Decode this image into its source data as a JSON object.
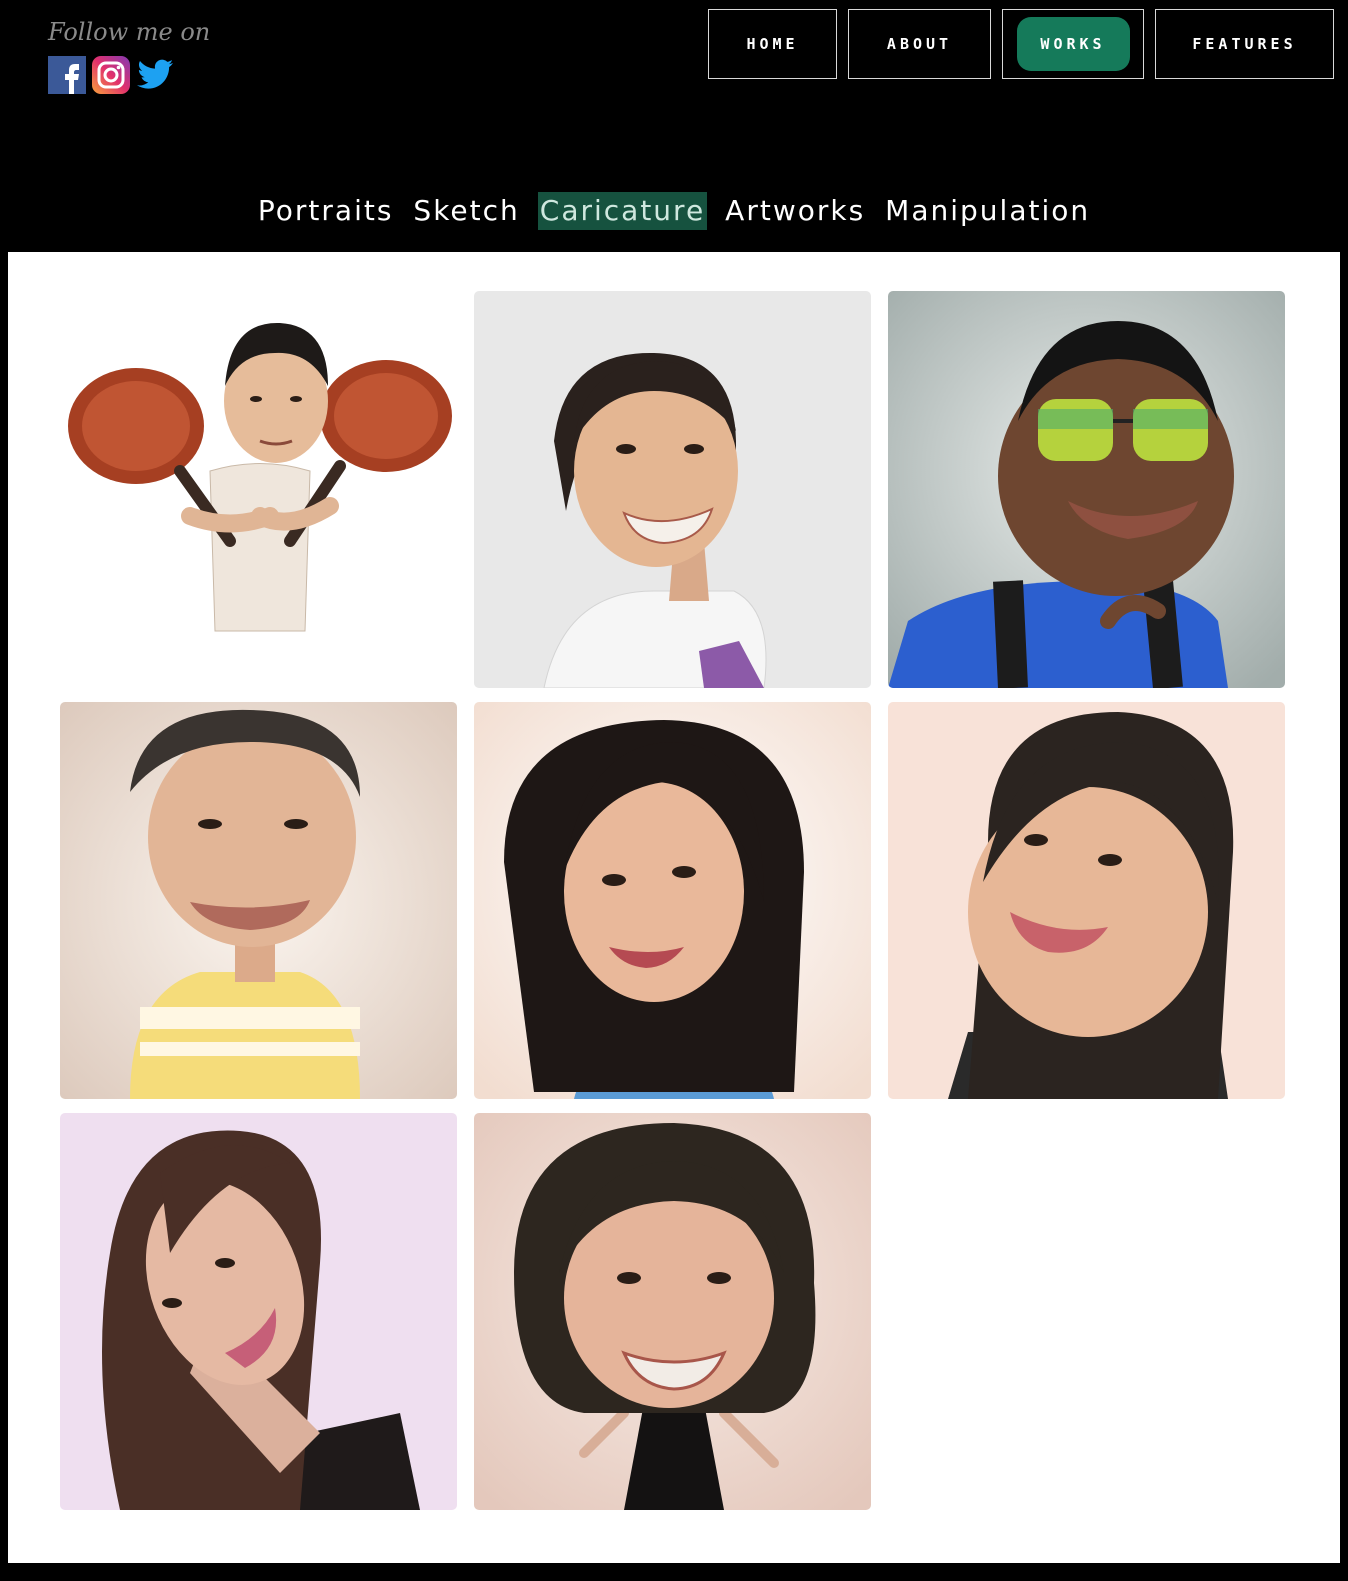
{
  "header": {
    "follow_text": "Follow me on",
    "social": [
      {
        "name": "facebook-icon",
        "color": "#3b5998"
      },
      {
        "name": "instagram-icon",
        "color": "#c13584"
      },
      {
        "name": "twitter-icon",
        "color": "#1da1f2"
      }
    ]
  },
  "nav": {
    "items": [
      {
        "label": "HOME",
        "active": false
      },
      {
        "label": "ABOUT",
        "active": false
      },
      {
        "label": "WORKS",
        "active": true
      },
      {
        "label": "FEATURES",
        "active": false
      }
    ],
    "active_color": "#157a5a"
  },
  "categories": {
    "items": [
      {
        "label": "Portraits",
        "active": false
      },
      {
        "label": "Sketch",
        "active": false
      },
      {
        "label": "Caricature",
        "active": true
      },
      {
        "label": "Artworks",
        "active": false
      },
      {
        "label": "Manipulation",
        "active": false
      }
    ]
  },
  "gallery": {
    "items": [
      {
        "name": "caricature-chef-with-pans",
        "bg": "#ffffff"
      },
      {
        "name": "caricature-woman-white-shirt",
        "bg": "#e8e8e8"
      },
      {
        "name": "caricature-man-sunglasses",
        "bg": "#b9c1c0"
      },
      {
        "name": "caricature-man-yellow-polo",
        "bg": "#e6d6cc"
      },
      {
        "name": "caricature-woman-striped-shirt",
        "bg": "#f6e8e0"
      },
      {
        "name": "caricature-woman-smiling",
        "bg": "#f8e2d8"
      },
      {
        "name": "caricature-woman-tilted-head",
        "bg": "#efdff0"
      },
      {
        "name": "caricature-woman-black-dress",
        "bg": "#edd8cf"
      }
    ]
  }
}
